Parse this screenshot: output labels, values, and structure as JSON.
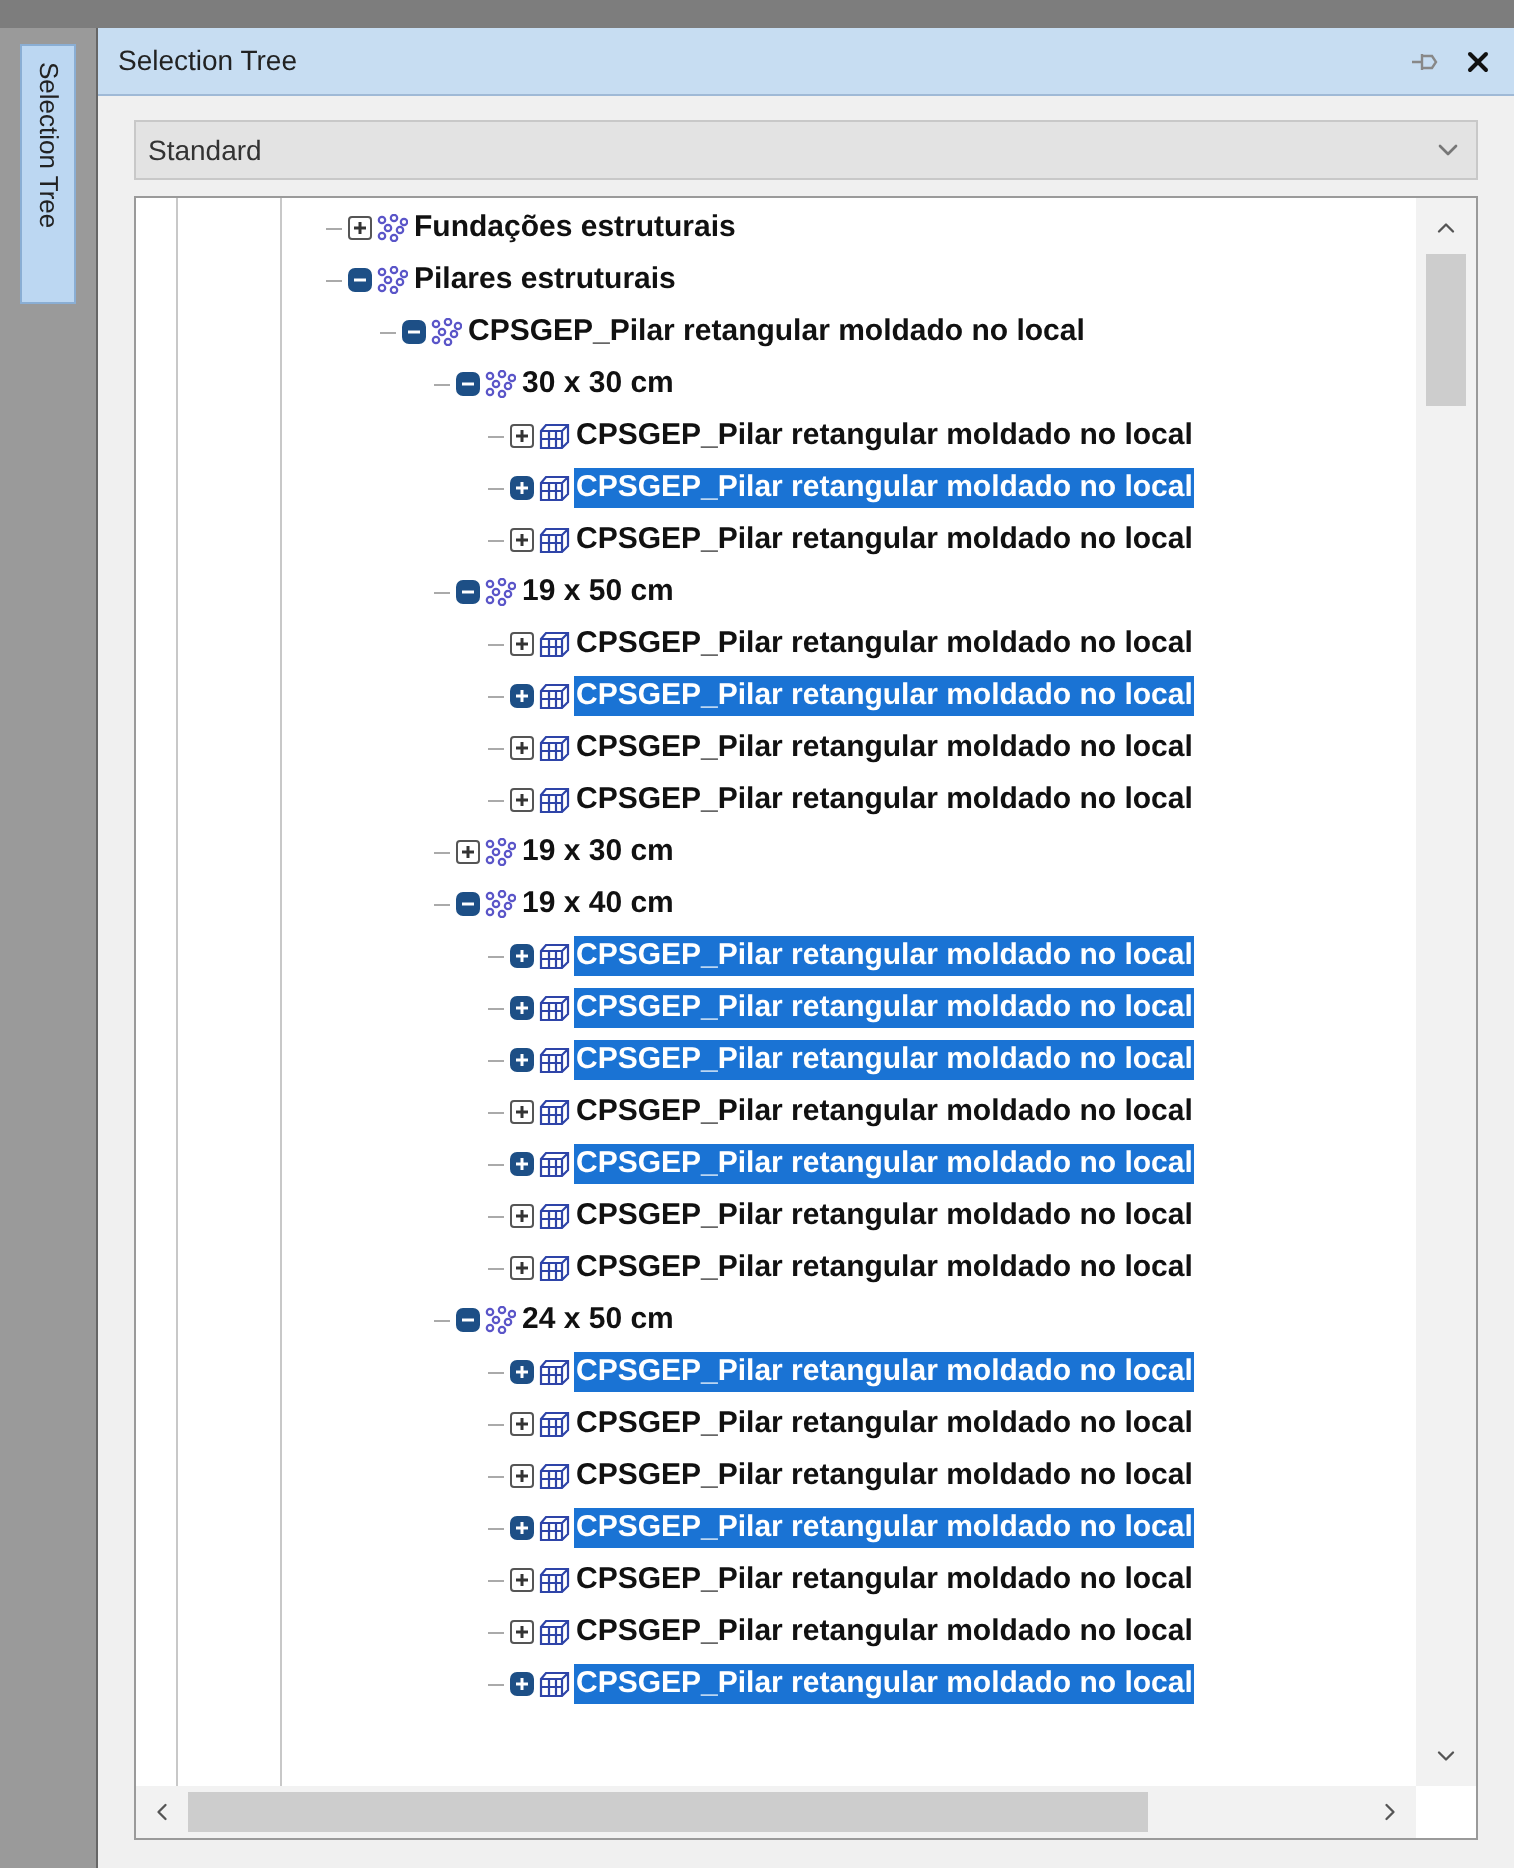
{
  "side_tab": {
    "label": "Selection Tree",
    "selected": true
  },
  "panel": {
    "title": "Selection Tree"
  },
  "dropdown": {
    "value": "Standard"
  },
  "tree": [
    {
      "label": "Fundações estruturais",
      "kind": "group",
      "expanded": false,
      "selected": false
    },
    {
      "label": "Pilares estruturais",
      "kind": "group",
      "expanded": true,
      "selected": false,
      "children": [
        {
          "label": "CPSGEP_Pilar retangular moldado no local",
          "kind": "group",
          "expanded": true,
          "selected": false,
          "children": [
            {
              "label": "30 x 30 cm",
              "kind": "group",
              "expanded": true,
              "selected": false,
              "children": [
                {
                  "label": "CPSGEP_Pilar retangular moldado no local",
                  "kind": "item",
                  "expanded": false,
                  "selected": false
                },
                {
                  "label": "CPSGEP_Pilar retangular moldado no local",
                  "kind": "item",
                  "expanded": false,
                  "selected": true
                },
                {
                  "label": "CPSGEP_Pilar retangular moldado no local",
                  "kind": "item",
                  "expanded": false,
                  "selected": false
                }
              ]
            },
            {
              "label": "19 x 50 cm",
              "kind": "group",
              "expanded": true,
              "selected": false,
              "children": [
                {
                  "label": "CPSGEP_Pilar retangular moldado no local",
                  "kind": "item",
                  "expanded": false,
                  "selected": false
                },
                {
                  "label": "CPSGEP_Pilar retangular moldado no local",
                  "kind": "item",
                  "expanded": false,
                  "selected": true
                },
                {
                  "label": "CPSGEP_Pilar retangular moldado no local",
                  "kind": "item",
                  "expanded": false,
                  "selected": false
                },
                {
                  "label": "CPSGEP_Pilar retangular moldado no local",
                  "kind": "item",
                  "expanded": false,
                  "selected": false
                }
              ]
            },
            {
              "label": "19 x 30 cm",
              "kind": "group",
              "expanded": false,
              "selected": false
            },
            {
              "label": "19 x 40 cm",
              "kind": "group",
              "expanded": true,
              "selected": false,
              "children": [
                {
                  "label": "CPSGEP_Pilar retangular moldado no local",
                  "kind": "item",
                  "expanded": false,
                  "selected": true
                },
                {
                  "label": "CPSGEP_Pilar retangular moldado no local",
                  "kind": "item",
                  "expanded": false,
                  "selected": true
                },
                {
                  "label": "CPSGEP_Pilar retangular moldado no local",
                  "kind": "item",
                  "expanded": false,
                  "selected": true
                },
                {
                  "label": "CPSGEP_Pilar retangular moldado no local",
                  "kind": "item",
                  "expanded": false,
                  "selected": false
                },
                {
                  "label": "CPSGEP_Pilar retangular moldado no local",
                  "kind": "item",
                  "expanded": false,
                  "selected": true
                },
                {
                  "label": "CPSGEP_Pilar retangular moldado no local",
                  "kind": "item",
                  "expanded": false,
                  "selected": false
                },
                {
                  "label": "CPSGEP_Pilar retangular moldado no local",
                  "kind": "item",
                  "expanded": false,
                  "selected": false
                }
              ]
            },
            {
              "label": "24 x 50 cm",
              "kind": "group",
              "expanded": true,
              "selected": false,
              "children": [
                {
                  "label": "CPSGEP_Pilar retangular moldado no local",
                  "kind": "item",
                  "expanded": false,
                  "selected": true
                },
                {
                  "label": "CPSGEP_Pilar retangular moldado no local",
                  "kind": "item",
                  "expanded": false,
                  "selected": false
                },
                {
                  "label": "CPSGEP_Pilar retangular moldado no local",
                  "kind": "item",
                  "expanded": false,
                  "selected": false
                },
                {
                  "label": "CPSGEP_Pilar retangular moldado no local",
                  "kind": "item",
                  "expanded": false,
                  "selected": true
                },
                {
                  "label": "CPSGEP_Pilar retangular moldado no local",
                  "kind": "item",
                  "expanded": false,
                  "selected": false
                },
                {
                  "label": "CPSGEP_Pilar retangular moldado no local",
                  "kind": "item",
                  "expanded": false,
                  "selected": false
                },
                {
                  "label": "CPSGEP_Pilar retangular moldado no local",
                  "kind": "item",
                  "expanded": false,
                  "selected": true
                }
              ]
            }
          ]
        }
      ]
    }
  ]
}
